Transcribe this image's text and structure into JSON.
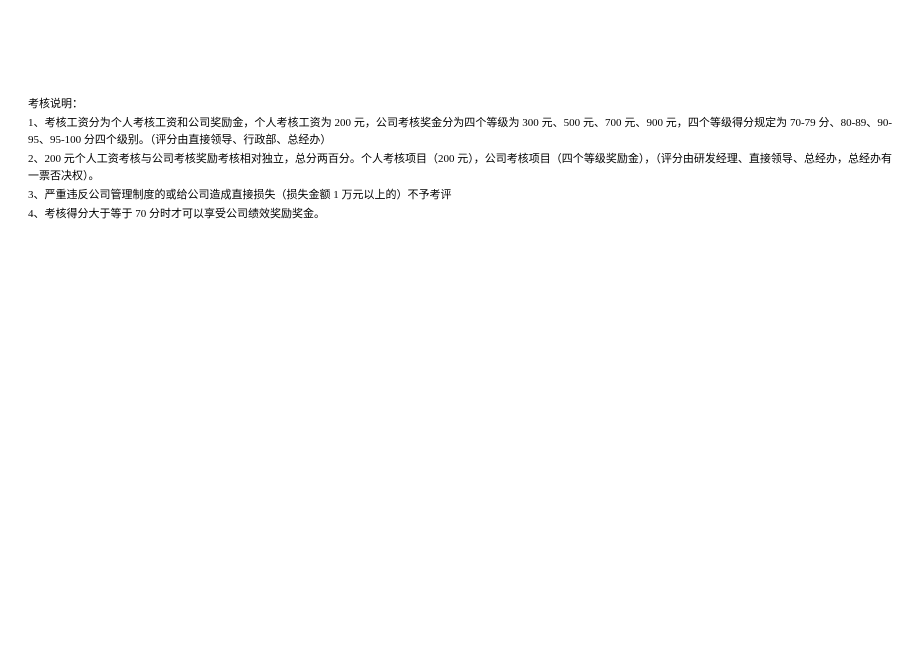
{
  "title": "考核说明：",
  "items": [
    "1、考核工资分为个人考核工资和公司奖励金，个人考核工资为 200 元，公司考核奖金分为四个等级为 300 元、500 元、700 元、900 元，四个等级得分规定为 70-79 分、80-89、90-95、95-100 分四个级别。（评分由直接领导、行政部、总经办）",
    "2、200 元个人工资考核与公司考核奖励考核相对独立，总分两百分。个人考核项目（200 元），公司考核项目（四个等级奖励金），（评分由研发经理、直接领导、总经办，总经办有一票否决权）。",
    "3、严重违反公司管理制度的或给公司造成直接损失（损失金额 1 万元以上的）不予考评",
    "4、考核得分大于等于 70 分时才可以享受公司绩效奖励奖金。"
  ]
}
